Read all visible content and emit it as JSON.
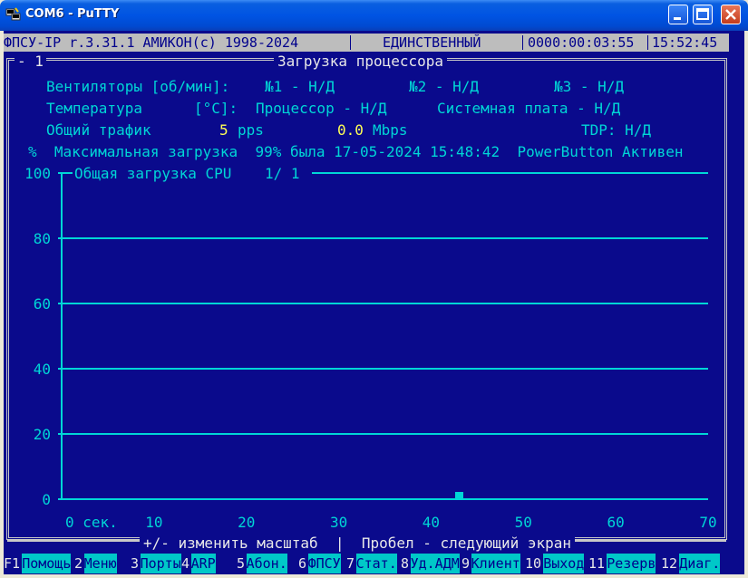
{
  "window": {
    "title": "COM6 - PuTTY"
  },
  "status": {
    "app": "ФПСУ-IP r.3.31.1 АМИКОН(с) 1998-2024",
    "mode": "ЕДИНСТВЕННЫЙ",
    "uptime": "0000:00:03:55",
    "clock": "15:52:45"
  },
  "frame": {
    "number": "- 1",
    "title": "Загрузка процессора"
  },
  "info": {
    "fans_label": "Вентиляторы [об/мин]:",
    "fan1": "№1 - Н/Д",
    "fan2": "№2 - Н/Д",
    "fan3": "№3 - Н/Д",
    "temp_label": "Температура",
    "temp_unit": "[°C]:",
    "temp_cpu": "Процессор - Н/Д",
    "temp_board": "Системная плата - Н/Д",
    "traffic_label": "Общий трафик",
    "traffic_pps_value": "5",
    "traffic_pps_unit": "pps",
    "traffic_mbps_value": "0.0",
    "traffic_mbps_unit": "Mbps",
    "tdp": "TDP: Н/Д",
    "max_line": "%  Максимальная загрузка  99% была 17-05-2024 15:48:42  PowerButton Активен"
  },
  "chart_data": {
    "type": "bar",
    "title": "Общая загрузка CPU",
    "page_indicator": "1/  1",
    "ylim": [
      0,
      100
    ],
    "yticks": [
      "0",
      "20",
      "40",
      "60",
      "80",
      "100"
    ],
    "xlim": [
      0,
      70
    ],
    "xticks": [
      "0 сек.",
      "10",
      "20",
      "30",
      "40",
      "50",
      "60",
      "70"
    ],
    "x": [
      43
    ],
    "values": [
      2
    ],
    "grid": true,
    "colors": {
      "line": "#00d6d6",
      "bar": "#00d6d6",
      "background": "#0a0a8c"
    }
  },
  "hint": "+/- изменить масштаб  |  Пробел - следующий экран",
  "fkeys": [
    {
      "num": "F1",
      "label": "Помощь"
    },
    {
      "num": "2",
      "label": "Меню"
    },
    {
      "num": "3",
      "label": "Порты"
    },
    {
      "num": "4",
      "label": "ARP"
    },
    {
      "num": "5",
      "label": "Абон."
    },
    {
      "num": "6",
      "label": "ФПСУ"
    },
    {
      "num": "7",
      "label": "Стат."
    },
    {
      "num": "8",
      "label": "Уд.АДМ"
    },
    {
      "num": "9",
      "label": "Клиент"
    },
    {
      "num": "10",
      "label": "Выход"
    },
    {
      "num": "11",
      "label": "Резерв"
    },
    {
      "num": "12",
      "label": "Диаг."
    }
  ]
}
